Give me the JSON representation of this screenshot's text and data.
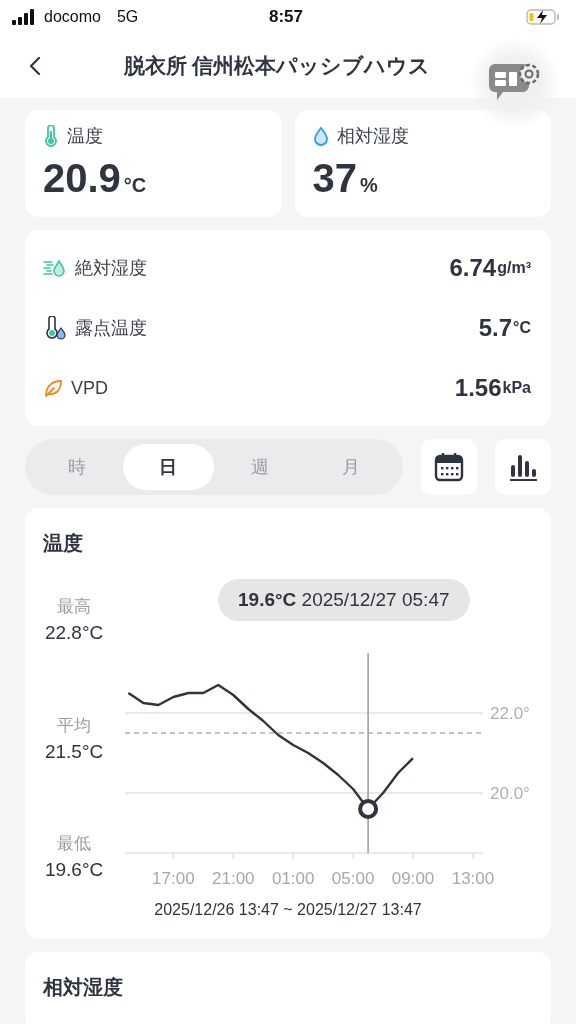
{
  "status_bar": {
    "carrier": "docomo",
    "network": "5G",
    "time": "8:57"
  },
  "header": {
    "title": "脱衣所 信州松本パッシブハウス"
  },
  "current": [
    {
      "kind": "temperature",
      "label": "温度",
      "value": "20.9",
      "unit": "°C"
    },
    {
      "kind": "humidity",
      "label": "相対湿度",
      "value": "37",
      "unit": "%"
    }
  ],
  "details": [
    {
      "kind": "absolute",
      "label": "絶対湿度",
      "value": "6.74",
      "unit": "g/m³"
    },
    {
      "kind": "dew",
      "label": "露点温度",
      "value": "5.7",
      "unit": "°C"
    },
    {
      "kind": "vpd",
      "label": "VPD",
      "value": "1.56",
      "unit": "kPa"
    }
  ],
  "periods": [
    {
      "label": "時",
      "selected": false
    },
    {
      "label": "日",
      "selected": true
    },
    {
      "label": "週",
      "selected": false
    },
    {
      "label": "月",
      "selected": false
    }
  ],
  "chart_card": {
    "stats": [
      {
        "label": "最高",
        "value": "22.8°C"
      },
      {
        "label": "平均",
        "value": "21.5°C"
      },
      {
        "label": "最低",
        "value": "19.6°C"
      }
    ],
    "tooltip": "**19.6°C** 2025/12/27 05:47",
    "range": "2025/12/26 13:47 ~ 2025/12/27 13:47",
    "chart_data": {
      "type": "line",
      "title": "温度",
      "categories": [
        null,
        null,
        null,
        "17:00",
        null,
        null,
        null,
        "21:00",
        null,
        null,
        null,
        "01:00",
        null,
        null,
        null,
        "05:00",
        null,
        null,
        null,
        "09:00",
        null,
        null,
        null,
        "13:00"
      ],
      "series": [
        {
          "color": "#2f3440",
          "values": [
            22.5,
            22.25,
            22.2,
            22.4,
            22.5,
            22.5,
            22.7,
            22.45,
            22.1,
            21.8,
            21.45,
            21.2,
            21.0,
            20.75,
            20.45,
            20.1,
            19.6,
            20.0,
            20.5,
            20.87,
            null,
            null,
            null,
            null
          ]
        }
      ],
      "ylim": [
        18.5,
        23.5
      ],
      "yticks": [
        {
          "value": 20,
          "label": "20.0°"
        },
        {
          "value": 22,
          "label": "22.0°"
        }
      ],
      "ref_lines": [
        {
          "value": 21.5,
          "axis": "y"
        }
      ]
    }
  },
  "next_card": {
    "title": "相対湿度"
  }
}
